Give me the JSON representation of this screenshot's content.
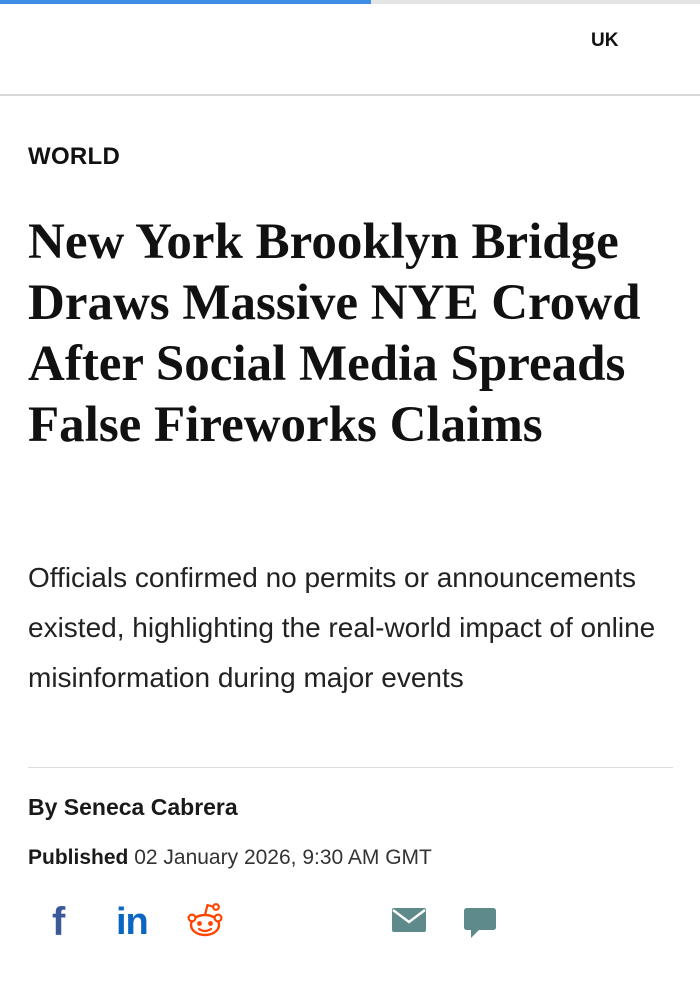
{
  "page": {
    "reading_progress_percent": 53
  },
  "header": {
    "region_label": "UK"
  },
  "article": {
    "section": "WORLD",
    "headline": "New York Brooklyn Bridge Draws Massive NYE Crowd After Social Media Spreads False Fireworks Claims",
    "standfirst": "Officials confirmed no permits or announcements existed, highlighting the real-world impact of online misinformation during major events",
    "byline_prefix": "By",
    "author": "Seneca Cabrera",
    "published_label": "Published",
    "published_date": "02 January 2026, 9:30 AM GMT"
  },
  "share": {
    "icons": [
      "facebook-icon",
      "linkedin-icon",
      "reddit-icon",
      "email-icon",
      "comment-icon"
    ],
    "facebook_glyph": "f",
    "linkedin_glyph": "in",
    "colors": {
      "facebook": "#3b5998",
      "linkedin": "#0a66c2",
      "reddit": "#ff4500",
      "email": "#5f8a8b",
      "comment": "#5f8a8b"
    }
  },
  "colors": {
    "progress": "#3d8ce6",
    "text": "#111111"
  }
}
